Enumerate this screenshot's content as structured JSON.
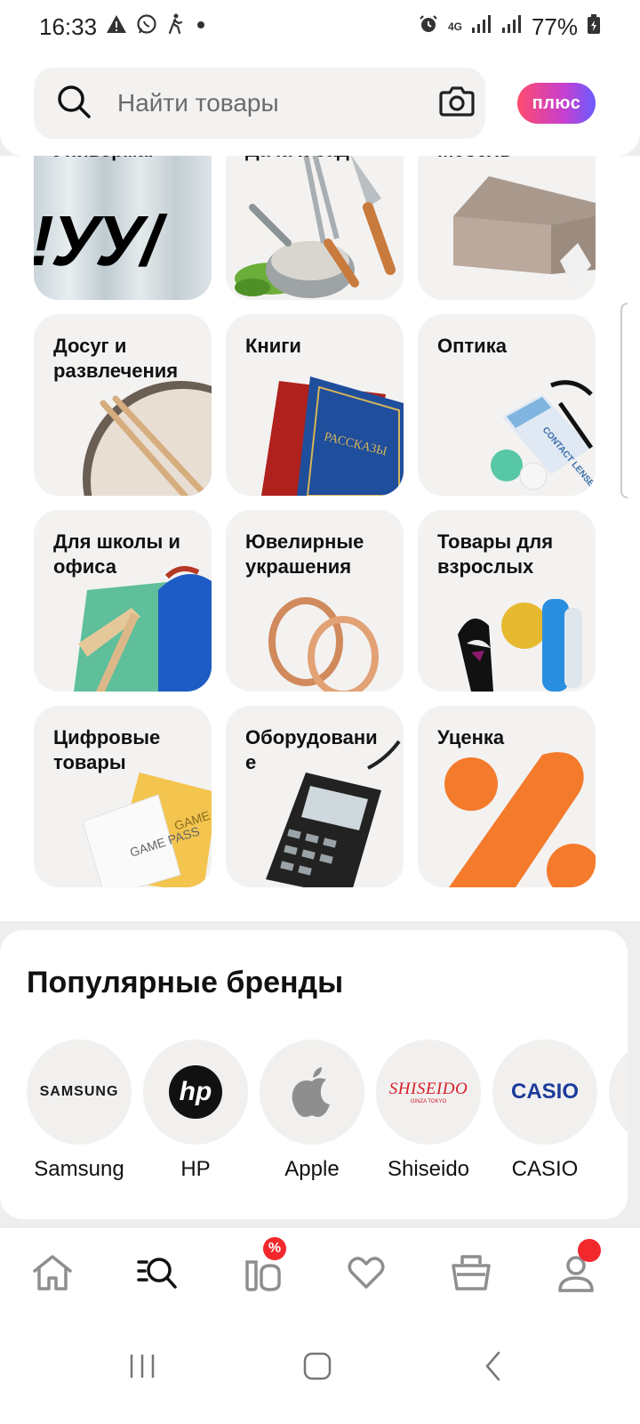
{
  "status_bar": {
    "time": "16:33",
    "battery": "77%",
    "network": "4G",
    "icons": [
      "warning-icon",
      "whatsapp-icon",
      "walking-icon",
      "dot-icon",
      "alarm-icon",
      "signal-icon",
      "signal-icon",
      "battery-icon"
    ]
  },
  "search": {
    "placeholder": "Найти товары",
    "camera_icon": "camera-icon"
  },
  "plus_badge": {
    "label": "плюс"
  },
  "categories": [
    {
      "label": "Универмаг",
      "art": "univermag"
    },
    {
      "label": "Дача и сад",
      "art": "garden"
    },
    {
      "label": "Мебель",
      "art": "furniture"
    },
    {
      "label": "Досуг и развлечения",
      "art": "drum"
    },
    {
      "label": "Книги",
      "art": "books"
    },
    {
      "label": "Оптика",
      "art": "optics"
    },
    {
      "label": "Для школы и офиса",
      "art": "school"
    },
    {
      "label": "Ювелирные украшения",
      "art": "rings"
    },
    {
      "label": "Товары для взрослых",
      "art": "adult"
    },
    {
      "label": "Цифровые товары",
      "art": "digital"
    },
    {
      "label": "Оборудовани е",
      "art": "terminal"
    },
    {
      "label": "Уценка",
      "art": "discount"
    }
  ],
  "brands": {
    "title": "Популярные бренды",
    "items": [
      {
        "name": "Samsung",
        "logo_text": "SAMSUNG"
      },
      {
        "name": "HP",
        "logo_text": "hp"
      },
      {
        "name": "Apple",
        "logo_text": ""
      },
      {
        "name": "Shiseido",
        "logo_text": "SHISEIDO",
        "logo_sub": "GINZA TOKYO"
      },
      {
        "name": "CASIO",
        "logo_text": "CASIO"
      }
    ]
  },
  "book_text": "РАССКАЗЫ",
  "game_pass": "GAME PASS",
  "lens_text": "CONTACT LENSES",
  "bottom_nav": {
    "items": [
      "home-icon",
      "catalog-search-icon",
      "sale-icon",
      "favorites-icon",
      "cart-icon",
      "profile-icon"
    ],
    "sale_badge": "%"
  },
  "colors": {
    "accent_red": "#f2282d",
    "discount_orange": "#f47a2c",
    "casio_blue": "#1d3b9a",
    "shiseido_red": "#d51e28"
  }
}
